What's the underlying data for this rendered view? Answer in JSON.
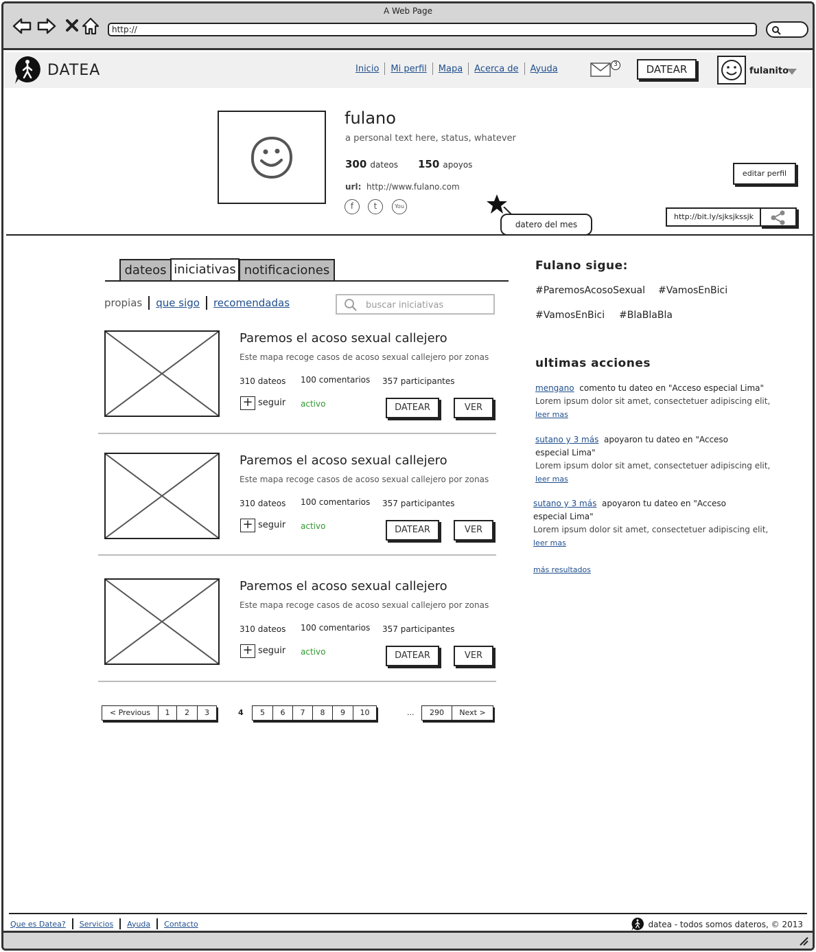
{
  "window": {
    "title": "A Web Page",
    "url": "http://"
  },
  "brand": {
    "name": "DATEA"
  },
  "nav": {
    "items": [
      "Inicio",
      "Mi perfil",
      "Mapa",
      "Acerca de",
      "Ayuda"
    ]
  },
  "header": {
    "mail_count": "3",
    "datear_label": "DATEAR",
    "username": "fulanito"
  },
  "profile": {
    "name": "fulano",
    "status": "a personal text here, status, whatever",
    "dateos_count": "300",
    "dateos_label": "dateos",
    "apoyos_count": "150",
    "apoyos_label": "apoyos",
    "url_label": "url:",
    "url_value": "http://www.fulano.com",
    "badge_label": "datero del mes",
    "edit_label": "editar perfil",
    "short_url": "http://bit.ly/sjksjkssjk"
  },
  "tabs": [
    "dateos",
    "iniciativas",
    "notificaciones"
  ],
  "subnav": {
    "propias": "propias",
    "que_sigo": "que sigo",
    "recomendadas": "recomendadas"
  },
  "search": {
    "placeholder": "buscar iniciativas"
  },
  "initiatives": [
    {
      "title": "Paremos el acoso sexual callejero",
      "desc": "Este mapa recoge casos de acoso sexual callejero por zonas",
      "dateos": "310 dateos",
      "comentarios": "100 comentarios",
      "participantes": "357 participantes",
      "follow": "seguir",
      "status": "activo",
      "datear": "DATEAR",
      "ver": "VER"
    },
    {
      "title": "Paremos el acoso sexual callejero",
      "desc": "Este mapa recoge casos de acoso sexual callejero por zonas",
      "dateos": "310 dateos",
      "comentarios": "100 comentarios",
      "participantes": "357 participantes",
      "follow": "seguir",
      "status": "activo",
      "datear": "DATEAR",
      "ver": "VER"
    },
    {
      "title": "Paremos el acoso sexual callejero",
      "desc": "Este mapa recoge casos de acoso sexual callejero por zonas",
      "dateos": "310 dateos",
      "comentarios": "100 comentarios",
      "participantes": "357 participantes",
      "follow": "seguir",
      "status": "activo",
      "datear": "DATEAR",
      "ver": "VER"
    }
  ],
  "pagination": {
    "prev": "< Previous",
    "next": "Next >",
    "pages_a": [
      "1",
      "2",
      "3"
    ],
    "current": "4",
    "pages_b": [
      "5",
      "6",
      "7",
      "8",
      "9",
      "10"
    ],
    "ellipsis": "...",
    "last": "290"
  },
  "sidebar": {
    "follows_title": "Fulano sigue:",
    "tags": [
      "#ParemosAcosoSexual",
      "#VamosEnBici",
      "#VamosEnBici",
      "#BlaBlaBla"
    ],
    "actions_title": "ultimas acciones",
    "actions": [
      {
        "user": "mengano",
        "text": "comento tu dateo en \"Acceso especial Lima\"",
        "body": "Lorem ipsum dolor sit amet, consectetuer adipiscing elit,",
        "more": "leer mas"
      },
      {
        "user": "sutano y 3 más",
        "text": "apoyaron tu dateo en \"Acceso especial Lima\"",
        "body": "Lorem ipsum dolor sit amet, consectetuer adipiscing elit,",
        "more": "leer mas"
      },
      {
        "user": "sutano y 3 más",
        "text": "apoyaron tu dateo en \"Acceso especial Lima\"",
        "body": "Lorem ipsum dolor sit amet, consectetuer adipiscing elit,",
        "more": "leer mas"
      }
    ],
    "more_results": "más resultados"
  },
  "footer": {
    "links": [
      "Que es Datea?",
      "Servicios",
      "Ayuda",
      "Contacto"
    ],
    "copyright": "datea - todos somos dateros, © 2013"
  },
  "icons": [
    "back-arrow-icon",
    "forward-arrow-icon",
    "close-icon",
    "home-icon",
    "search-icon",
    "logo-icon",
    "mail-icon",
    "smiley-icon",
    "caret-down-icon",
    "facebook-icon",
    "twitter-icon",
    "youtube-icon",
    "star-icon",
    "share-icon",
    "plus-icon",
    "resize-grip-icon"
  ]
}
